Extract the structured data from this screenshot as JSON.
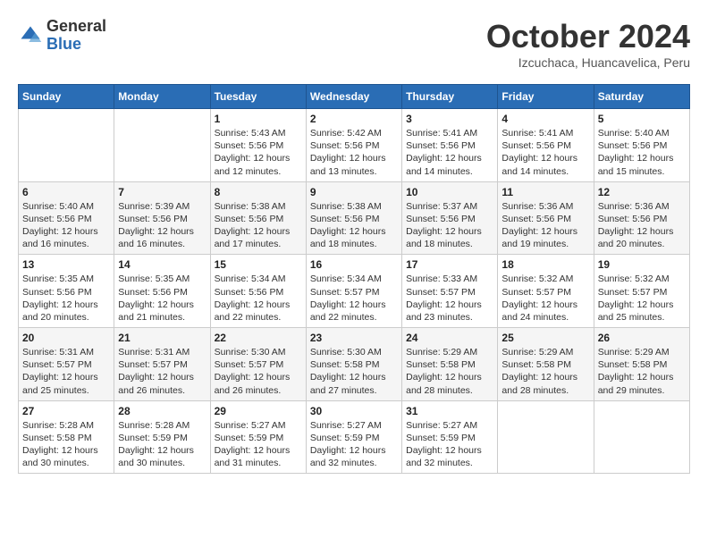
{
  "header": {
    "logo": {
      "general": "General",
      "blue": "Blue"
    },
    "title": "October 2024",
    "location": "Izcuchaca, Huancavelica, Peru"
  },
  "calendar": {
    "days_of_week": [
      "Sunday",
      "Monday",
      "Tuesday",
      "Wednesday",
      "Thursday",
      "Friday",
      "Saturday"
    ],
    "weeks": [
      [
        {
          "day": "",
          "info": ""
        },
        {
          "day": "",
          "info": ""
        },
        {
          "day": "1",
          "info": "Sunrise: 5:43 AM\nSunset: 5:56 PM\nDaylight: 12 hours and 12 minutes."
        },
        {
          "day": "2",
          "info": "Sunrise: 5:42 AM\nSunset: 5:56 PM\nDaylight: 12 hours and 13 minutes."
        },
        {
          "day": "3",
          "info": "Sunrise: 5:41 AM\nSunset: 5:56 PM\nDaylight: 12 hours and 14 minutes."
        },
        {
          "day": "4",
          "info": "Sunrise: 5:41 AM\nSunset: 5:56 PM\nDaylight: 12 hours and 14 minutes."
        },
        {
          "day": "5",
          "info": "Sunrise: 5:40 AM\nSunset: 5:56 PM\nDaylight: 12 hours and 15 minutes."
        }
      ],
      [
        {
          "day": "6",
          "info": "Sunrise: 5:40 AM\nSunset: 5:56 PM\nDaylight: 12 hours and 16 minutes."
        },
        {
          "day": "7",
          "info": "Sunrise: 5:39 AM\nSunset: 5:56 PM\nDaylight: 12 hours and 16 minutes."
        },
        {
          "day": "8",
          "info": "Sunrise: 5:38 AM\nSunset: 5:56 PM\nDaylight: 12 hours and 17 minutes."
        },
        {
          "day": "9",
          "info": "Sunrise: 5:38 AM\nSunset: 5:56 PM\nDaylight: 12 hours and 18 minutes."
        },
        {
          "day": "10",
          "info": "Sunrise: 5:37 AM\nSunset: 5:56 PM\nDaylight: 12 hours and 18 minutes."
        },
        {
          "day": "11",
          "info": "Sunrise: 5:36 AM\nSunset: 5:56 PM\nDaylight: 12 hours and 19 minutes."
        },
        {
          "day": "12",
          "info": "Sunrise: 5:36 AM\nSunset: 5:56 PM\nDaylight: 12 hours and 20 minutes."
        }
      ],
      [
        {
          "day": "13",
          "info": "Sunrise: 5:35 AM\nSunset: 5:56 PM\nDaylight: 12 hours and 20 minutes."
        },
        {
          "day": "14",
          "info": "Sunrise: 5:35 AM\nSunset: 5:56 PM\nDaylight: 12 hours and 21 minutes."
        },
        {
          "day": "15",
          "info": "Sunrise: 5:34 AM\nSunset: 5:56 PM\nDaylight: 12 hours and 22 minutes."
        },
        {
          "day": "16",
          "info": "Sunrise: 5:34 AM\nSunset: 5:57 PM\nDaylight: 12 hours and 22 minutes."
        },
        {
          "day": "17",
          "info": "Sunrise: 5:33 AM\nSunset: 5:57 PM\nDaylight: 12 hours and 23 minutes."
        },
        {
          "day": "18",
          "info": "Sunrise: 5:32 AM\nSunset: 5:57 PM\nDaylight: 12 hours and 24 minutes."
        },
        {
          "day": "19",
          "info": "Sunrise: 5:32 AM\nSunset: 5:57 PM\nDaylight: 12 hours and 25 minutes."
        }
      ],
      [
        {
          "day": "20",
          "info": "Sunrise: 5:31 AM\nSunset: 5:57 PM\nDaylight: 12 hours and 25 minutes."
        },
        {
          "day": "21",
          "info": "Sunrise: 5:31 AM\nSunset: 5:57 PM\nDaylight: 12 hours and 26 minutes."
        },
        {
          "day": "22",
          "info": "Sunrise: 5:30 AM\nSunset: 5:57 PM\nDaylight: 12 hours and 26 minutes."
        },
        {
          "day": "23",
          "info": "Sunrise: 5:30 AM\nSunset: 5:58 PM\nDaylight: 12 hours and 27 minutes."
        },
        {
          "day": "24",
          "info": "Sunrise: 5:29 AM\nSunset: 5:58 PM\nDaylight: 12 hours and 28 minutes."
        },
        {
          "day": "25",
          "info": "Sunrise: 5:29 AM\nSunset: 5:58 PM\nDaylight: 12 hours and 28 minutes."
        },
        {
          "day": "26",
          "info": "Sunrise: 5:29 AM\nSunset: 5:58 PM\nDaylight: 12 hours and 29 minutes."
        }
      ],
      [
        {
          "day": "27",
          "info": "Sunrise: 5:28 AM\nSunset: 5:58 PM\nDaylight: 12 hours and 30 minutes."
        },
        {
          "day": "28",
          "info": "Sunrise: 5:28 AM\nSunset: 5:59 PM\nDaylight: 12 hours and 30 minutes."
        },
        {
          "day": "29",
          "info": "Sunrise: 5:27 AM\nSunset: 5:59 PM\nDaylight: 12 hours and 31 minutes."
        },
        {
          "day": "30",
          "info": "Sunrise: 5:27 AM\nSunset: 5:59 PM\nDaylight: 12 hours and 32 minutes."
        },
        {
          "day": "31",
          "info": "Sunrise: 5:27 AM\nSunset: 5:59 PM\nDaylight: 12 hours and 32 minutes."
        },
        {
          "day": "",
          "info": ""
        },
        {
          "day": "",
          "info": ""
        }
      ]
    ]
  }
}
